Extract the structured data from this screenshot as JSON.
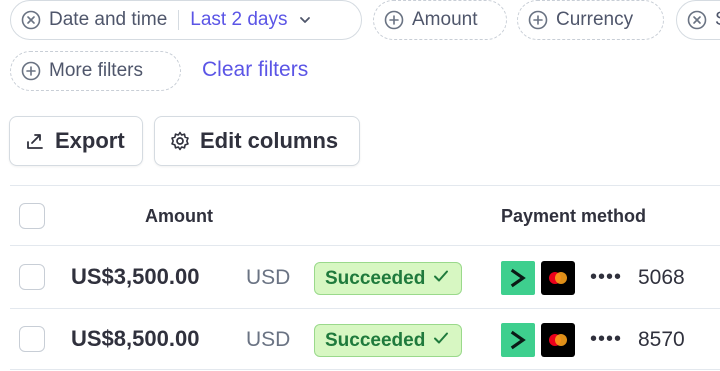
{
  "filters": {
    "date": {
      "label": "Date and time",
      "value": "Last 2 days"
    },
    "amount": {
      "label": "Amount"
    },
    "currency": {
      "label": "Currency"
    },
    "status": {
      "label": "S"
    },
    "more": {
      "label": "More filters"
    },
    "clear_label": "Clear filters"
  },
  "toolbar": {
    "export_label": "Export",
    "edit_columns_label": "Edit columns"
  },
  "table": {
    "headers": {
      "amount": "Amount",
      "payment_method": "Payment method"
    },
    "rows": [
      {
        "amount": "US$3,500.00",
        "currency": "USD",
        "status": "Succeeded",
        "card_dots": "••••",
        "last4": "5068"
      },
      {
        "amount": "US$8,500.00",
        "currency": "USD",
        "status": "Succeeded",
        "card_dots": "••••",
        "last4": "8570"
      }
    ]
  },
  "colors": {
    "accent": "#5b55e6",
    "success_bg": "#d7f7c2",
    "success_text": "#1f7a3c",
    "payment_icon_green": "#3ecf8e"
  }
}
